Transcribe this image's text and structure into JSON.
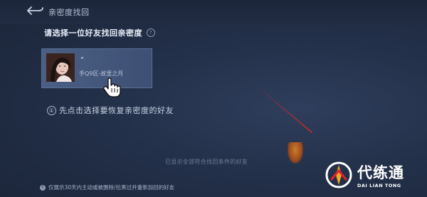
{
  "header": {
    "title": "亲密度找回"
  },
  "section": {
    "prompt": "请选择一位好友找回亲密度"
  },
  "friend": {
    "name_marker": "“",
    "server": "手Q9区-故里之月"
  },
  "hint": {
    "number": "①",
    "text": "先点击选择要恢复亲密度的好友"
  },
  "list_note": "已显示全部符合找回条件的好友",
  "footer": {
    "text": "仅展示30天内主动或被删除/拉黑过并重新加回的好友"
  },
  "watermark": {
    "name": "代练通",
    "pinyin": "DAI LIAN TONG"
  },
  "colors": {
    "accent_red": "#e0242b",
    "background": "#233049",
    "card": "#4b5f84"
  }
}
